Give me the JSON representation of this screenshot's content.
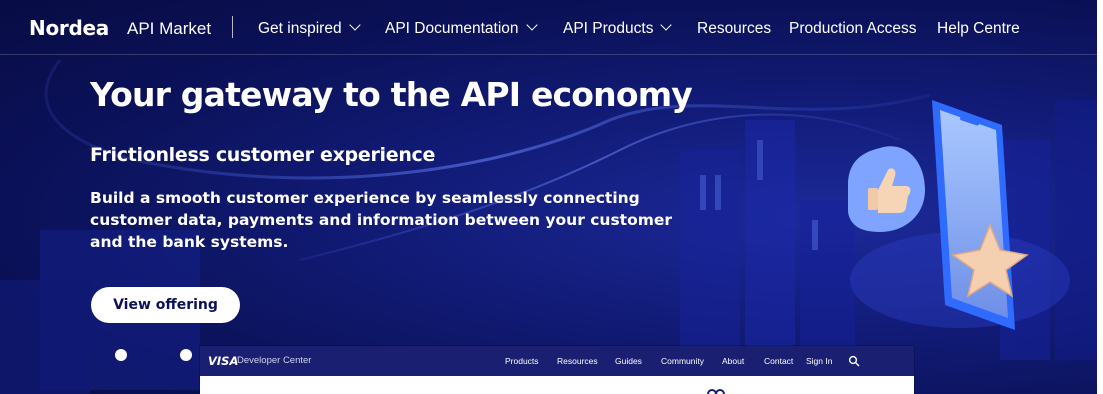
{
  "colors": {
    "hero_background": "#0b1158",
    "cta_text": "#0b1158",
    "visa_bar": "#1a1f71"
  },
  "header": {
    "logo": "Nordea",
    "product": "API Market",
    "nav": [
      {
        "label": "Get inspired",
        "dropdown": true
      },
      {
        "label": "API Documentation",
        "dropdown": true
      },
      {
        "label": "API Products",
        "dropdown": true
      },
      {
        "label": "Resources",
        "dropdown": false
      },
      {
        "label": "Production Access",
        "dropdown": false
      },
      {
        "label": "Help Centre",
        "dropdown": false
      }
    ]
  },
  "hero": {
    "headline": "Your gateway to the API economy",
    "subheadline": "Frictionless customer experience",
    "body": "Build a smooth customer experience by seamlessly connecting customer data, payments and information between your customer and the bank systems.",
    "cta": "View offering",
    "carousel_dots": 2,
    "illustration_icons": [
      "thumbs-up-icon",
      "star-icon",
      "phone-icon"
    ]
  },
  "visa_overlay": {
    "logo": "VISA",
    "title": "Developer Center",
    "nav": [
      "Products",
      "Resources",
      "Guides",
      "Community",
      "About",
      "Contact",
      "Sign In"
    ],
    "search_icon": "search-icon"
  }
}
